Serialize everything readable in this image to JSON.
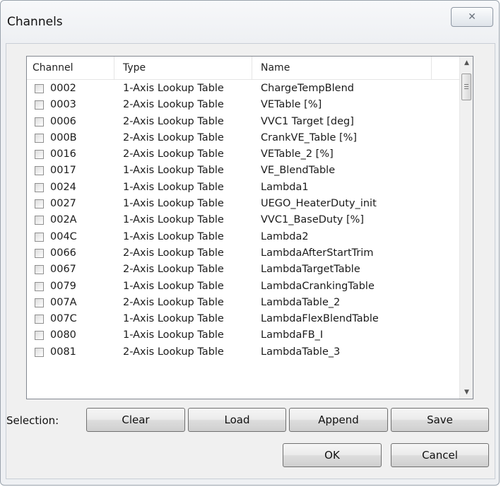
{
  "window": {
    "title": "Channels",
    "close_glyph": "✕"
  },
  "table": {
    "headers": {
      "channel": "Channel",
      "type": "Type",
      "name": "Name"
    },
    "rows": [
      {
        "channel": "0002",
        "type": "1-Axis Lookup Table",
        "name": "ChargeTempBlend"
      },
      {
        "channel": "0003",
        "type": "2-Axis Lookup Table",
        "name": "VETable [%]"
      },
      {
        "channel": "0006",
        "type": "2-Axis Lookup Table",
        "name": "VVC1 Target [deg]"
      },
      {
        "channel": "000B",
        "type": "2-Axis Lookup Table",
        "name": "CrankVE_Table [%]"
      },
      {
        "channel": "0016",
        "type": "2-Axis Lookup Table",
        "name": "VETable_2 [%]"
      },
      {
        "channel": "0017",
        "type": "1-Axis Lookup Table",
        "name": "VE_BlendTable"
      },
      {
        "channel": "0024",
        "type": "1-Axis Lookup Table",
        "name": "Lambda1"
      },
      {
        "channel": "0027",
        "type": "1-Axis Lookup Table",
        "name": "UEGO_HeaterDuty_init"
      },
      {
        "channel": "002A",
        "type": "1-Axis Lookup Table",
        "name": "VVC1_BaseDuty [%]"
      },
      {
        "channel": "004C",
        "type": "1-Axis Lookup Table",
        "name": "Lambda2"
      },
      {
        "channel": "0066",
        "type": "2-Axis Lookup Table",
        "name": "LambdaAfterStartTrim"
      },
      {
        "channel": "0067",
        "type": "2-Axis Lookup Table",
        "name": "LambdaTargetTable"
      },
      {
        "channel": "0079",
        "type": "1-Axis Lookup Table",
        "name": "LambdaCrankingTable"
      },
      {
        "channel": "007A",
        "type": "2-Axis Lookup Table",
        "name": "LambdaTable_2"
      },
      {
        "channel": "007C",
        "type": "1-Axis Lookup Table",
        "name": "LambdaFlexBlendTable"
      },
      {
        "channel": "0080",
        "type": "1-Axis Lookup Table",
        "name": "LambdaFB_I"
      },
      {
        "channel": "0081",
        "type": "2-Axis Lookup Table",
        "name": "LambdaTable_3"
      }
    ]
  },
  "selection": {
    "label": "Selection:",
    "clear": "Clear",
    "load": "Load",
    "append": "Append",
    "save": "Save"
  },
  "footer": {
    "ok": "OK",
    "cancel": "Cancel"
  }
}
